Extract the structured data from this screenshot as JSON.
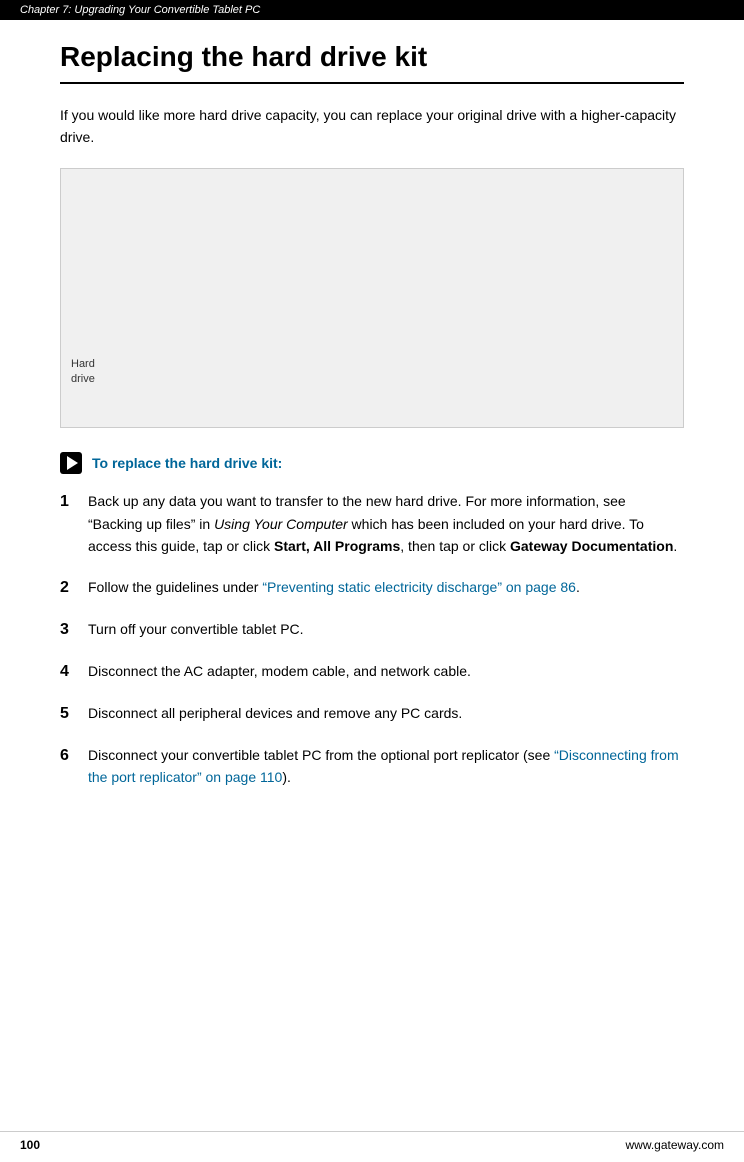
{
  "header": {
    "chapter_text": "Chapter 7: Upgrading Your Convertible Tablet PC"
  },
  "page": {
    "title": "Replacing the hard drive kit",
    "intro": "If you would like more hard drive capacity, you can replace your original drive with a higher-capacity drive.",
    "image_label_line1": "Hard",
    "image_label_line2": "drive",
    "procedure": {
      "title": "To replace the hard drive kit:",
      "play_icon_label": "play-icon"
    },
    "steps": [
      {
        "number": "1",
        "text_parts": [
          {
            "type": "normal",
            "text": "Back up any data you want to transfer to the new hard drive. For more information, see “Backing up files” in "
          },
          {
            "type": "italic",
            "text": "Using Your Computer"
          },
          {
            "type": "normal",
            "text": " which has been included on your hard drive. To access this guide, tap or click "
          },
          {
            "type": "bold",
            "text": "Start, All Programs"
          },
          {
            "type": "normal",
            "text": ", then tap or click "
          },
          {
            "type": "bold",
            "text": "Gateway Documentation"
          },
          {
            "type": "normal",
            "text": "."
          }
        ]
      },
      {
        "number": "2",
        "text_parts": [
          {
            "type": "normal",
            "text": "Follow the guidelines under "
          },
          {
            "type": "link",
            "text": "“Preventing static electricity discharge” on page 86"
          },
          {
            "type": "normal",
            "text": "."
          }
        ]
      },
      {
        "number": "3",
        "text_parts": [
          {
            "type": "normal",
            "text": "Turn off your convertible tablet PC."
          }
        ]
      },
      {
        "number": "4",
        "text_parts": [
          {
            "type": "normal",
            "text": "Disconnect the AC adapter, modem cable, and network cable."
          }
        ]
      },
      {
        "number": "5",
        "text_parts": [
          {
            "type": "normal",
            "text": "Disconnect all peripheral devices and remove any PC cards."
          }
        ]
      },
      {
        "number": "6",
        "text_parts": [
          {
            "type": "normal",
            "text": "Disconnect your convertible tablet PC from the optional port replicator (see "
          },
          {
            "type": "link",
            "text": "“Disconnecting from the port replicator” on page 110"
          },
          {
            "type": "normal",
            "text": ")."
          }
        ]
      }
    ],
    "footer": {
      "page_number": "100",
      "url": "www.gateway.com"
    }
  }
}
